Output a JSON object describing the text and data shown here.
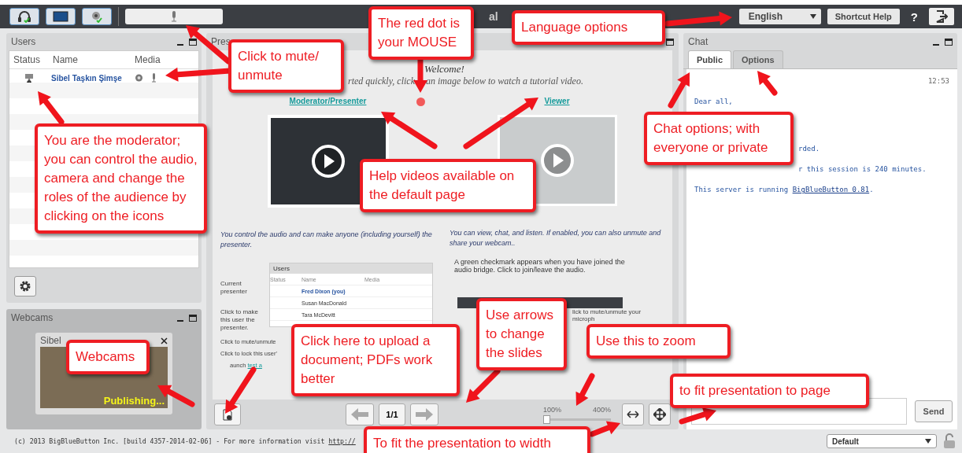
{
  "toolbar": {
    "title": "al",
    "language": "English",
    "shortcut_help": "Shortcut Help",
    "help": "?"
  },
  "users_panel": {
    "title": "Users",
    "columns": [
      "Status",
      "Name",
      "Media"
    ],
    "rows": [
      {
        "name": "Sibel Taşkın Şimşe"
      }
    ]
  },
  "webcams_panel": {
    "title": "Webcams",
    "video": {
      "name": "Sibel",
      "status": "Publishing..."
    }
  },
  "presentation": {
    "title": "Pres",
    "welcome": "Welcome!",
    "intro": [
      "rted quickly, click",
      "an image below to watch a tutorial video."
    ],
    "links": [
      "Moderator/Presenter",
      "Viewer"
    ],
    "left_text": "You control the audio and can make anyone (including yourself) the presenter.",
    "right_text": "You can view, chat, and listen.  If enabled, you can also unmute and share your webcam..",
    "mini_users": {
      "title": "Users",
      "columns": [
        "Status",
        "Name",
        "Media"
      ],
      "rows": [
        "Fred Dixon (you)",
        "Susan MacDonald",
        "Tara McDevitt"
      ]
    },
    "notes": [
      "Current presenter",
      "Click to make this user the presenter.",
      "Click to mute/unmute",
      "Click to lock this user'"
    ],
    "launch": "aunch ",
    "launch_link": "test a",
    "right_note": "A green checkmark appears when you have joined the audio bridge.  Click to join/leave the audio.",
    "right_notes": [
      "lick to mute/unmute your",
      "microph"
    ],
    "page": "1/1",
    "zoom_min": "100%",
    "zoom_max": "400%",
    "zoom": {
      "level": 0
    }
  },
  "chat": {
    "title": "Chat",
    "tabs": [
      {
        "label": "Public",
        "selected": true
      },
      {
        "label": "Options",
        "selected": false
      }
    ],
    "time": "12:53",
    "messages": [
      {
        "kind": "full",
        "text": "Dear all,"
      },
      {
        "kind": "cut",
        "text": "rded."
      },
      {
        "kind": "cut",
        "text": "r this session is 240 minutes."
      },
      {
        "kind": "link",
        "text": "This server is running ",
        "link": "BigBlueButton 0.81",
        "after": "."
      }
    ],
    "send": "Send"
  },
  "footer": {
    "text": "(c) 2013 BigBlueButton Inc. [build 4357-2014-02-06] - For more information visit ",
    "link": "http://",
    "layout": "Default"
  },
  "callouts": [
    "Click to mute/ unmute",
    "The red dot is your MOUSE",
    "Language options",
    "You are the moderator; you can control the audio, camera and change the roles of the audience by clicking on the icons",
    "Chat options; with everyone or private",
    "Help videos available on the default page",
    "Webcams",
    "Click here to upload a document; PDFs work better",
    "Use arrows to change the slides",
    "Use this to zoom",
    "to fit presentation to page",
    "To fit the presentation to width"
  ]
}
